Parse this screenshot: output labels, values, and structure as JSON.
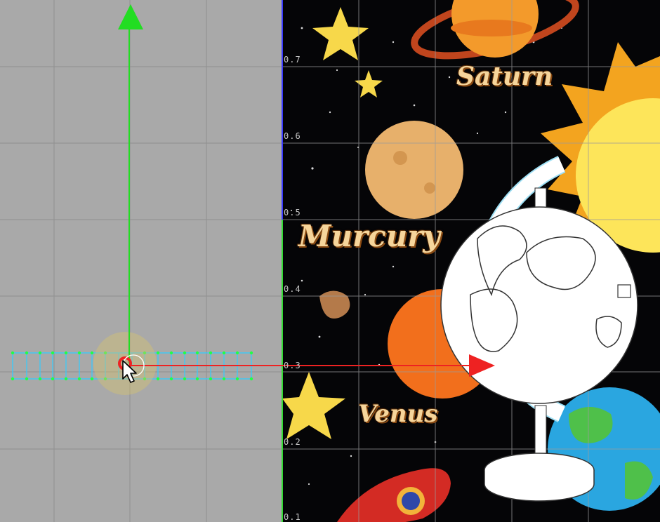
{
  "viewport": {
    "background_color": "#a9a9a9",
    "grid_color": "#8f8f8f",
    "uv_boundary_color": "#3a3aff"
  },
  "uv_axis_labels": [
    "0.7",
    "0.6",
    "0.5",
    "0.4",
    "0.3",
    "0.2",
    "0.1"
  ],
  "texture": {
    "planet_labels": {
      "saturn": "Saturn",
      "mercury": "Murcury",
      "venus": "Venus"
    }
  },
  "gizmo": {
    "y_axis_color": "#22dd22",
    "x_axis_color": "#ee2222",
    "pivot_color": "#ee2222"
  },
  "mesh": {
    "wire_color": "#33ccff",
    "vertex_color": "#22ff44"
  }
}
